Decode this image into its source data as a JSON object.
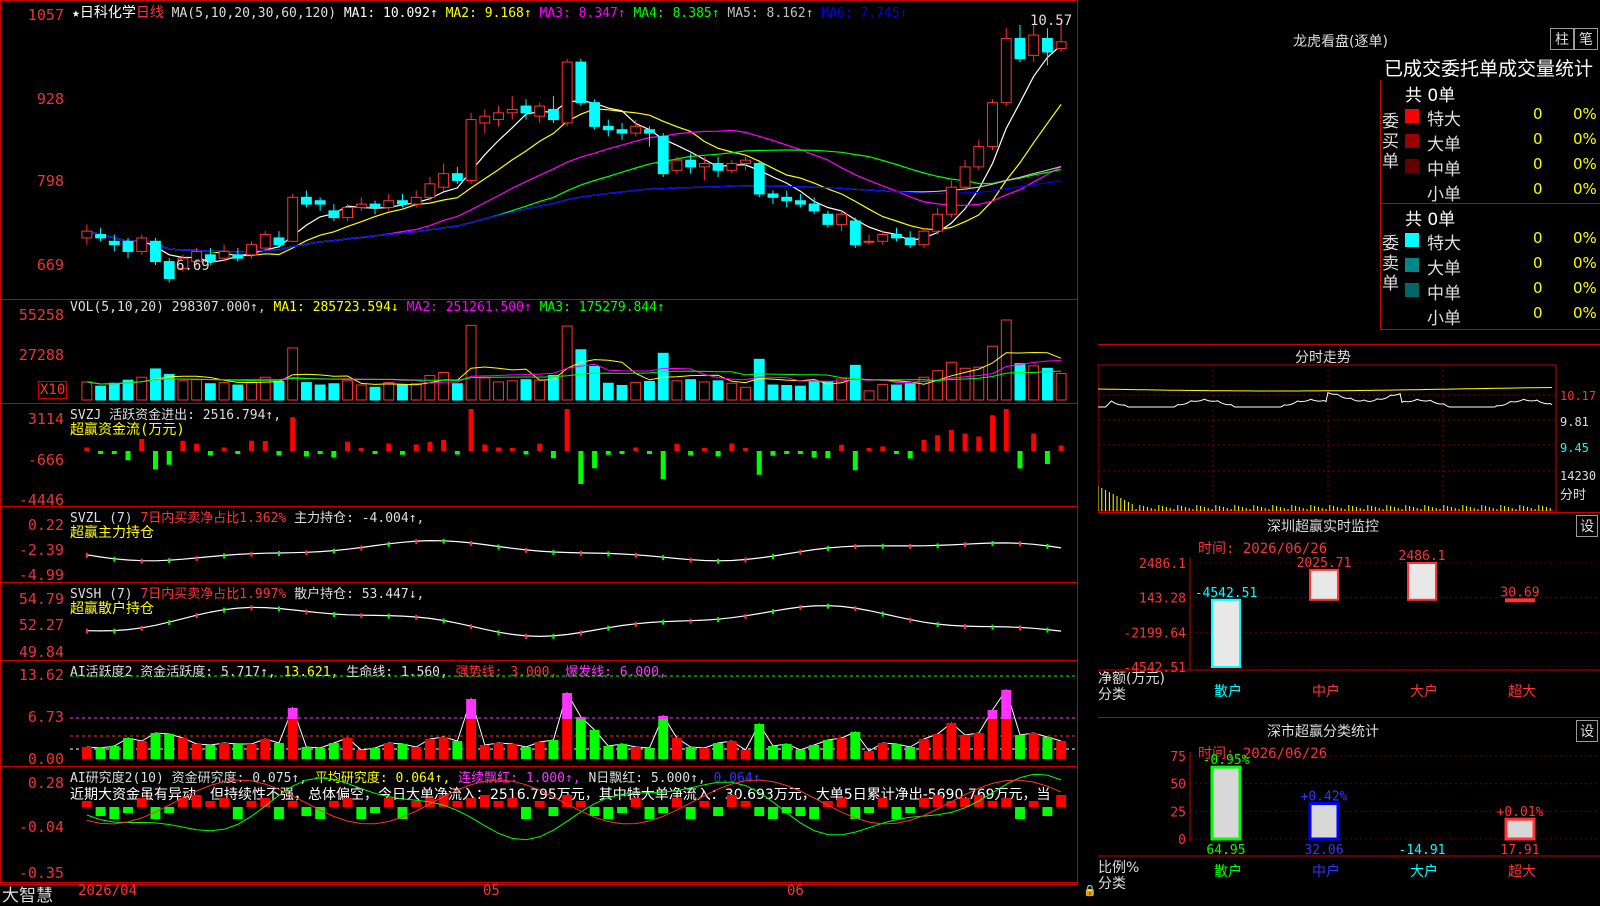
{
  "header": {
    "star": "★",
    "stock_name": "日科化学",
    "period": "日线",
    "ma_params": "MA(5,10,20,30,60,120)",
    "ma": [
      {
        "label": "MA1: 10.092↑",
        "color": "#ffffff"
      },
      {
        "label": "MA2: 9.168↑",
        "color": "#ffff00"
      },
      {
        "label": "MA3: 8.347↑",
        "color": "#ff00ff"
      },
      {
        "label": "MA4: 8.385↑",
        "color": "#00ff00"
      },
      {
        "label": "MA5: 8.162↑",
        "color": "#c0c0c0"
      },
      {
        "label": "MA6: 7.745↑",
        "color": "#0000ff"
      }
    ]
  },
  "main_yaxis": [
    "1057",
    "928",
    "798",
    "669"
  ],
  "price_annotations": {
    "high": "10.57",
    "low": "6.69"
  },
  "vol": {
    "yaxis": [
      "55258",
      "27288"
    ],
    "unit": "X10",
    "params": "VOL(5,10,20)",
    "value": "298307.000↑",
    "ma": [
      {
        "label": "MA1: 285723.594↓",
        "color": "#ffff00"
      },
      {
        "label": "MA2: 251261.500↑",
        "color": "#ff00ff"
      },
      {
        "label": "MA3: 175279.844↑",
        "color": "#00ff00"
      }
    ]
  },
  "svzj": {
    "yaxis": [
      "3114",
      "-666",
      "-4446"
    ],
    "line1": "SVZJ  活跃资金进出: 2516.794↑,",
    "line2": "超赢资金流(万元)"
  },
  "svzl": {
    "yaxis": [
      "0.22",
      "-2.39",
      "-4.99"
    ],
    "p1": "SVZL (7)",
    "p2": "7日内买卖净占比1.362%",
    "p3": "主力持仓: -4.004↑,",
    "line2": "超赢主力持仓"
  },
  "svsh": {
    "yaxis": [
      "54.79",
      "52.27",
      "49.84"
    ],
    "p1": "SVSH (7)",
    "p2": "7日内买卖净占比1.997%",
    "p3": "散户持仓: 53.447↓,",
    "line2": "超赢散户持仓"
  },
  "ai_active": {
    "yaxis": [
      "13.62",
      "6.73",
      "0.00"
    ],
    "parts": [
      {
        "text": "AI活跃度2 资金活跃度: 5.717↑,",
        "color": "#dddddd"
      },
      {
        "text": "13.621,",
        "color": "#ffff00"
      },
      {
        "text": "生命线: 1.560,",
        "color": "#dddddd"
      },
      {
        "text": "强势线: 3.000,",
        "color": "#ff3333"
      },
      {
        "text": "爆发线: 6.000,",
        "color": "#ff33ff"
      }
    ]
  },
  "ai_research": {
    "yaxis": [
      "0.28",
      "-0.04",
      "-0.35"
    ],
    "parts": [
      {
        "text": "AI研究度2(10) 资金研究度: 0.075↑,",
        "color": "#dddddd"
      },
      {
        "text": "平均研究度: 0.064↑,",
        "color": "#ffff00"
      },
      {
        "text": "连续飘红: 1.000↑,",
        "color": "#ff33ff"
      },
      {
        "text": "N日飘红: 5.000↑,",
        "color": "#dddddd"
      },
      {
        "text": "0.064↑",
        "color": "#3333ff"
      }
    ],
    "comment": "近期大资金虽有异动，但持续性不强，总体偏空，今日大单净流入：2516.795万元，其中特大单净流入：30.693万元，大单5日累计净出-5690.769万元，当"
  },
  "xaxis": {
    "d1": "2026/04",
    "d2": "05",
    "d3": "06"
  },
  "brand": "大智慧",
  "right": {
    "lhb_title": "龙虎看盘(逐单)",
    "tab1": "柱",
    "tab2": "笔",
    "subtitle": "已成交委托单成交量统计",
    "buy_label": "委买单",
    "sell_label": "委卖单",
    "buy_total": "共 0单",
    "sell_total": "共 0单",
    "buy_rows": [
      {
        "name": "特大",
        "value": "0",
        "pct": "0%",
        "color": "#ff0000"
      },
      {
        "name": "大单",
        "value": "0",
        "pct": "0%",
        "color": "#990000"
      },
      {
        "name": "中单",
        "value": "0",
        "pct": "0%",
        "color": "#660000"
      },
      {
        "name": "小单",
        "value": "0",
        "pct": "0%",
        "color": "#000000"
      }
    ],
    "sell_rows": [
      {
        "name": "特大",
        "value": "0",
        "pct": "0%",
        "color": "#00ffff"
      },
      {
        "name": "大单",
        "value": "0",
        "pct": "0%",
        "color": "#008888"
      },
      {
        "name": "中单",
        "value": "0",
        "pct": "0%",
        "color": "#006666"
      },
      {
        "name": "小单",
        "value": "0",
        "pct": "0%",
        "color": "#000000"
      }
    ],
    "fenshi_title": "分时走势",
    "fenshi_y": [
      "10.17",
      "9.81",
      "9.45",
      "14230"
    ],
    "fenshi_unit": "分时",
    "sz_monitor_title": "深圳超赢实时监控",
    "sz_monitor_btn": "设",
    "sz_time": "时间: 2026/06/26",
    "sz_y": [
      "2486.1",
      "143.28",
      "-2199.64",
      "-4542.51"
    ],
    "sz_ylabel1": "净额(万元)",
    "sz_ylabel2": "分类",
    "sz_cats": [
      "散户",
      "中户",
      "大户",
      "超大"
    ],
    "sz_labels": [
      "-4542.51",
      "2025.71",
      "2486.1",
      "30.69"
    ],
    "sz_values": [
      -4542.51,
      2025.71,
      2486.1,
      30.69
    ],
    "sz_class_title": "深市超赢分类统计",
    "sz_class_btn": "设",
    "sz_class_time": "时间: 2026/06/26",
    "cls_y": [
      "75",
      "50",
      "25",
      "0"
    ],
    "cls_ylabel1": "比例%",
    "cls_ylabel2": "分类",
    "cls_cats": [
      "散户",
      "中户",
      "大户",
      "超大"
    ],
    "cls_values": [
      64.95,
      32.06,
      -14.91,
      17.91
    ],
    "cls_value_labels": [
      "64.95",
      "32.06",
      "-14.91",
      "17.91"
    ],
    "cls_change": [
      "-0.95%",
      "+0.42%",
      "",
      "+0.01%"
    ]
  },
  "chart_data": {
    "type": "candlestick",
    "title": "日科化学 日线",
    "ylim": [
      6.69,
      10.57
    ],
    "candles": [
      [
        7.35,
        7.45,
        7.55,
        7.25
      ],
      [
        7.4,
        7.35,
        7.5,
        7.3
      ],
      [
        7.3,
        7.25,
        7.4,
        7.15
      ],
      [
        7.3,
        7.15,
        7.35,
        7.05
      ],
      [
        7.15,
        7.35,
        7.4,
        7.1
      ],
      [
        7.3,
        7.0,
        7.35,
        6.95
      ],
      [
        7.0,
        6.75,
        7.05,
        6.69
      ],
      [
        6.9,
        7.05,
        7.1,
        6.85
      ],
      [
        7.0,
        7.15,
        7.2,
        6.95
      ],
      [
        7.1,
        7.0,
        7.2,
        6.95
      ],
      [
        7.05,
        7.15,
        7.25,
        7.0
      ],
      [
        7.1,
        7.05,
        7.2,
        7.0
      ],
      [
        7.1,
        7.25,
        7.3,
        7.05
      ],
      [
        7.2,
        7.4,
        7.45,
        7.15
      ],
      [
        7.35,
        7.25,
        7.45,
        7.2
      ],
      [
        7.3,
        7.95,
        8.0,
        7.3
      ],
      [
        7.95,
        7.85,
        8.05,
        7.8
      ],
      [
        7.9,
        7.85,
        7.95,
        7.75
      ],
      [
        7.75,
        7.65,
        7.85,
        7.6
      ],
      [
        7.65,
        7.8,
        7.85,
        7.6
      ],
      [
        7.8,
        7.85,
        7.95,
        7.75
      ],
      [
        7.85,
        7.8,
        7.9,
        7.7
      ],
      [
        7.8,
        7.9,
        8.0,
        7.75
      ],
      [
        7.9,
        7.85,
        8.0,
        7.8
      ],
      [
        7.85,
        7.95,
        8.05,
        7.8
      ],
      [
        7.95,
        8.15,
        8.25,
        7.9
      ],
      [
        8.1,
        8.3,
        8.45,
        8.05
      ],
      [
        8.3,
        8.2,
        8.4,
        8.15
      ],
      [
        8.2,
        9.1,
        9.2,
        8.15
      ],
      [
        9.05,
        9.15,
        9.25,
        8.9
      ],
      [
        9.1,
        9.2,
        9.3,
        9.0
      ],
      [
        9.2,
        9.25,
        9.45,
        9.1
      ],
      [
        9.3,
        9.2,
        9.4,
        9.1
      ],
      [
        9.15,
        9.3,
        9.35,
        9.05
      ],
      [
        9.25,
        9.1,
        9.45,
        9.05
      ],
      [
        9.05,
        9.95,
        10.0,
        9.0
      ],
      [
        9.95,
        9.35,
        10.0,
        9.3
      ],
      [
        9.35,
        9.0,
        9.4,
        8.95
      ],
      [
        9.0,
        8.95,
        9.1,
        8.85
      ],
      [
        8.95,
        8.9,
        9.05,
        8.8
      ],
      [
        8.9,
        9.0,
        9.1,
        8.85
      ],
      [
        8.95,
        8.9,
        9.0,
        8.7
      ],
      [
        8.85,
        8.3,
        8.9,
        8.25
      ],
      [
        8.35,
        8.5,
        8.55,
        8.3
      ],
      [
        8.5,
        8.4,
        8.6,
        8.3
      ],
      [
        8.4,
        8.45,
        8.55,
        8.2
      ],
      [
        8.45,
        8.35,
        8.55,
        8.25
      ],
      [
        8.35,
        8.45,
        8.5,
        8.3
      ],
      [
        8.45,
        8.5,
        8.55,
        8.35
      ],
      [
        8.45,
        8.0,
        8.5,
        7.95
      ],
      [
        8.0,
        7.95,
        8.05,
        7.85
      ],
      [
        7.95,
        7.9,
        8.05,
        7.8
      ],
      [
        7.9,
        7.85,
        8.0,
        7.8
      ],
      [
        7.85,
        7.75,
        7.95,
        7.7
      ],
      [
        7.7,
        7.55,
        7.75,
        7.5
      ],
      [
        7.55,
        7.7,
        7.75,
        7.45
      ],
      [
        7.6,
        7.25,
        7.65,
        7.2
      ],
      [
        7.3,
        7.3,
        7.4,
        7.25
      ],
      [
        7.3,
        7.4,
        7.45,
        7.25
      ],
      [
        7.4,
        7.35,
        7.5,
        7.3
      ],
      [
        7.35,
        7.25,
        7.45,
        7.2
      ],
      [
        7.25,
        7.45,
        7.5,
        7.2
      ],
      [
        7.45,
        7.7,
        7.8,
        7.4
      ],
      [
        7.7,
        8.1,
        8.2,
        7.65
      ],
      [
        8.1,
        8.4,
        8.5,
        8.05
      ],
      [
        8.4,
        8.7,
        8.8,
        8.35
      ],
      [
        8.7,
        9.35,
        9.4,
        8.65
      ],
      [
        9.35,
        10.3,
        10.45,
        9.3
      ],
      [
        10.3,
        10.0,
        10.5,
        9.95
      ],
      [
        10.05,
        10.35,
        10.5,
        9.95
      ],
      [
        10.3,
        10.1,
        10.45,
        9.9
      ],
      [
        10.15,
        10.25,
        10.57,
        10.1
      ]
    ]
  }
}
